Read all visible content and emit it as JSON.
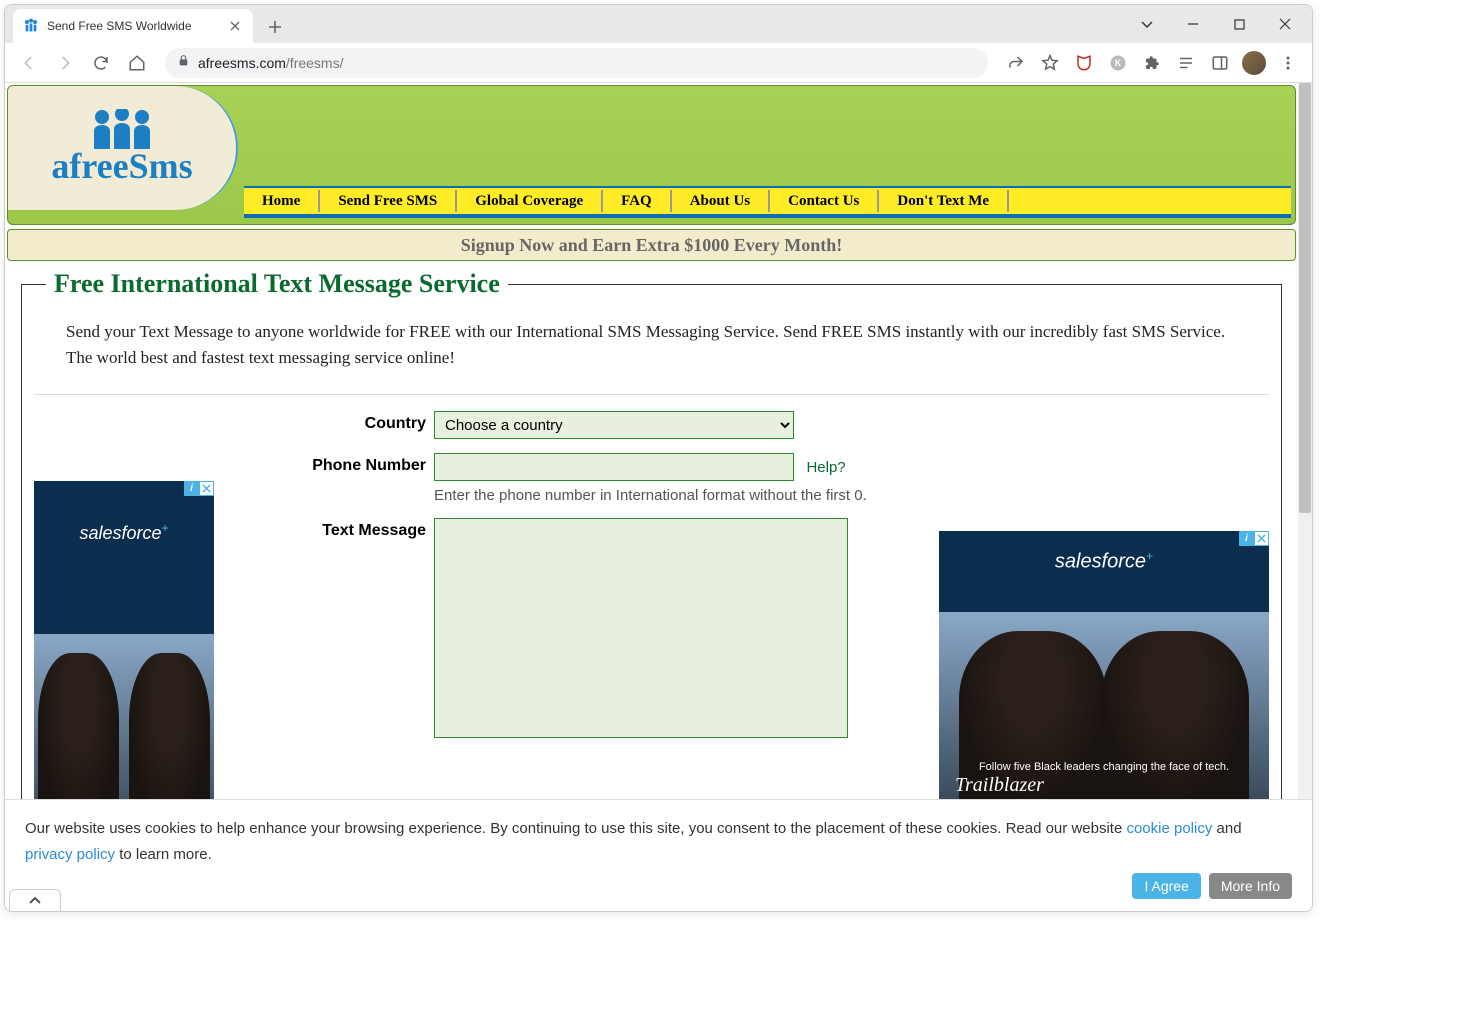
{
  "browser": {
    "tab_title": "Send Free SMS Worldwide",
    "url_prefix": "afreesms.com",
    "url_path": "/freesms/"
  },
  "nav": {
    "items": [
      "Home",
      "Send Free SMS",
      "Global Coverage",
      "FAQ",
      "About Us",
      "Contact Us",
      "Don't Text Me"
    ]
  },
  "logo": {
    "text": "afreeSms"
  },
  "promo": {
    "text": "Signup Now and Earn Extra $1000 Every Month!"
  },
  "page": {
    "heading": "Free International Text Message Service",
    "intro": "Send your Text Message to anyone worldwide for FREE with our International SMS Messaging Service. Send FREE SMS instantly with our incredibly fast SMS Service. The world best and fastest text messaging service online!"
  },
  "form": {
    "country_label": "Country",
    "country_selected": "Choose a country",
    "phone_label": "Phone Number",
    "phone_value": "",
    "help_text": "Help?",
    "phone_hint": "Enter the phone number in International format without the first 0.",
    "message_label": "Text Message",
    "message_value": ""
  },
  "ads": {
    "left": {
      "brand": "salesforce"
    },
    "right": {
      "brand": "salesforce",
      "caption": "Follow five Black leaders changing the face of tech.",
      "tagline": "Trailblazer"
    }
  },
  "cookie": {
    "text_1": "Our website uses cookies to help enhance your browsing experience. By continuing to use this site, you consent to the placement of these cookies. Read our website ",
    "link_1": "cookie policy",
    "text_2": " and ",
    "link_2": "privacy policy",
    "text_3": " to learn more.",
    "agree": "I Agree",
    "more": "More Info"
  }
}
